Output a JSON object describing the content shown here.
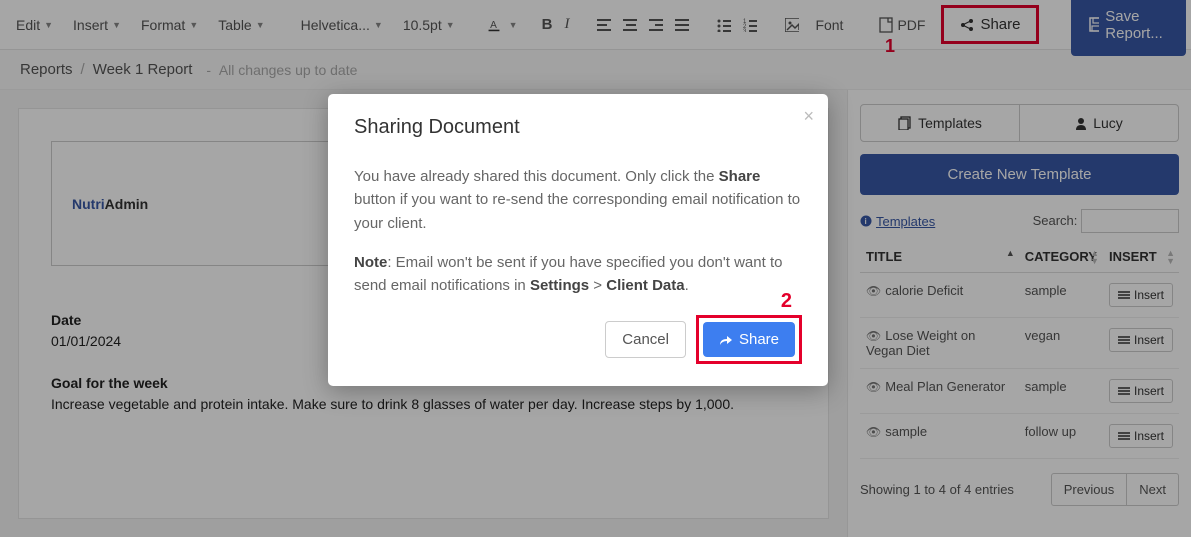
{
  "toolbar": {
    "edit": "Edit",
    "insert": "Insert",
    "format": "Format",
    "table": "Table",
    "font_family": "Helvetica...",
    "font_size": "10.5pt",
    "font_label": "Font",
    "pdf_label": "PDF",
    "share_label": "Share",
    "save_report_label": "Save Report..."
  },
  "annotations": {
    "one": "1",
    "two": "2"
  },
  "breadcrumb": {
    "root": "Reports",
    "page": "Week 1 Report",
    "status": "All changes up to date"
  },
  "document": {
    "brand1": "Nutri",
    "brand2": "Admin",
    "date_label": "Date",
    "date_value": "01/01/2024",
    "goal_label": "Goal for the week",
    "goal_text": "Increase vegetable and protein intake. Make sure to drink 8 glasses of water per day. Increase steps by 1,000."
  },
  "right": {
    "tab_templates": "Templates",
    "tab_user": "Lucy",
    "create_btn": "Create New Template",
    "templates_link": "Templates",
    "search_label": "Search:",
    "search_value": "",
    "cols": {
      "title": "TITLE",
      "category": "CATEGORY",
      "insert": "INSERT"
    },
    "rows": [
      {
        "title": "calorie Deficit",
        "category": "sample",
        "insert": "Insert"
      },
      {
        "title": "Lose Weight on Vegan Diet",
        "category": "vegan",
        "insert": "Insert"
      },
      {
        "title": "Meal Plan Generator",
        "category": "sample",
        "insert": "Insert"
      },
      {
        "title": "sample",
        "category": "follow up",
        "insert": "Insert"
      }
    ],
    "footer_text": "Showing 1 to 4 of 4 entries",
    "prev": "Previous",
    "next": "Next"
  },
  "modal": {
    "title": "Sharing Document",
    "p1_pre": "You have already shared this document. Only click the ",
    "p1_bold": "Share",
    "p1_post": " button if you want to re-send the corresponding email notification to your client.",
    "p2_pre": "Note",
    "p2_mid": ": Email won't be sent if you have specified you don't want to send email notifications in ",
    "p2_b1": "Settings",
    "p2_gt": " > ",
    "p2_b2": "Client Data",
    "p2_end": ".",
    "cancel": "Cancel",
    "share": "Share"
  }
}
